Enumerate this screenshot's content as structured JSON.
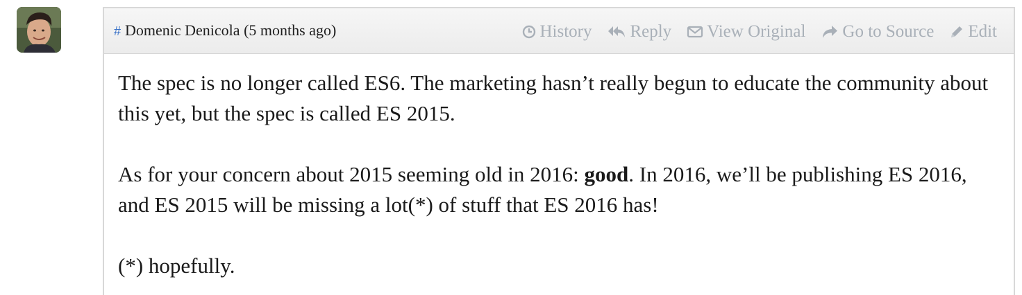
{
  "comment": {
    "author": "Domenic Denicola",
    "time": "(5 months ago)",
    "anchor_symbol": "#",
    "avatar_icon": "avatar-icon",
    "actions": {
      "history": "History",
      "reply": "Reply",
      "view_original": "View Original",
      "go_to_source": "Go to Source",
      "edit": "Edit"
    },
    "paragraph1": "The spec is no longer called ES6. The marketing hasn’t really begun to educate the community about this yet, but the spec is called ES 2015.",
    "paragraph2": {
      "before": "As for your concern about 2015 seeming old in 2016: ",
      "bold": "good",
      "after": ". In 2016, we’ll be publishing ES 2016, and ES 2015 will be missing a lot(*) of stuff that ES 2016 has!"
    },
    "paragraph3": "(*) hopefully."
  },
  "colors": {
    "link_blue": "#3a72c8",
    "action_gray": "#a9b0b8",
    "border": "#d8d8d8",
    "header_bg": "#efefef"
  }
}
